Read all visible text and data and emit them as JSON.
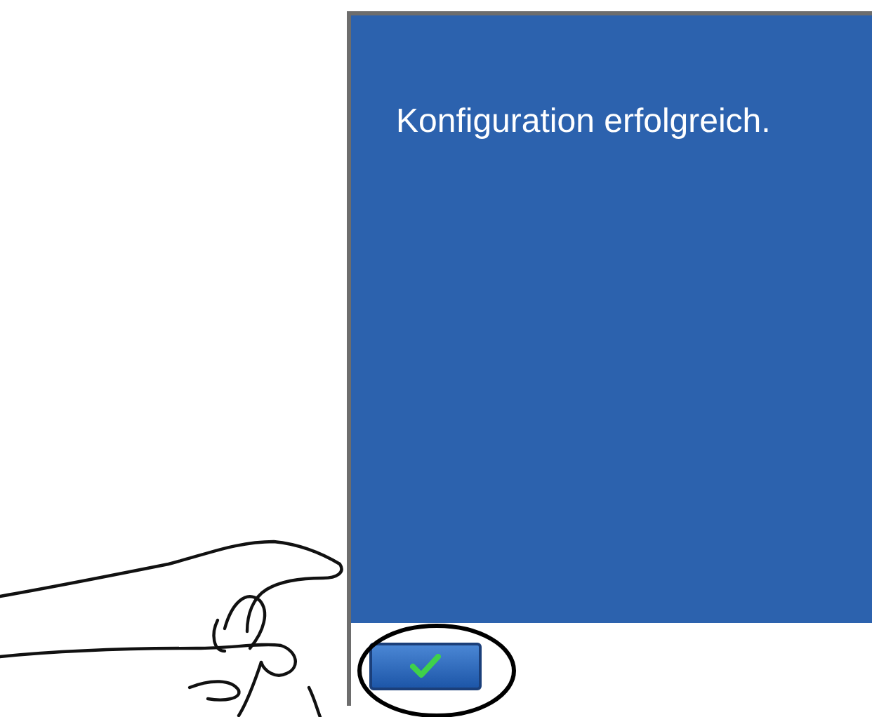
{
  "screen": {
    "message": "Konfiguration erfolgreich."
  }
}
